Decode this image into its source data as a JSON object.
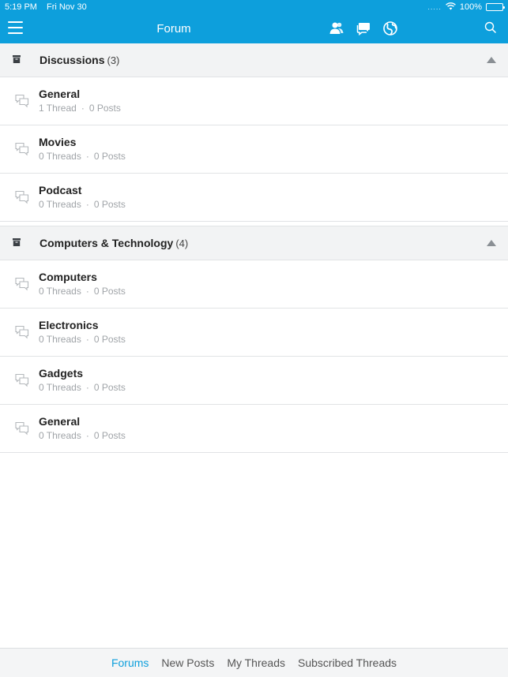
{
  "status_bar": {
    "time": "5:19 PM",
    "date": "Fri Nov 30",
    "battery": "100%",
    "signal_dots": "....."
  },
  "navbar": {
    "title": "Forum",
    "icons": [
      "members-icon",
      "conversations-icon",
      "globe-icon",
      "search-icon"
    ]
  },
  "categories": [
    {
      "title": "Discussions",
      "count": "(3)",
      "forums": [
        {
          "name": "General",
          "threads": "1 Thread",
          "posts": "0 Posts"
        },
        {
          "name": "Movies",
          "threads": "0 Threads",
          "posts": "0 Posts"
        },
        {
          "name": "Podcast",
          "threads": "0 Threads",
          "posts": "0 Posts"
        }
      ]
    },
    {
      "title": "Computers & Technology",
      "count": "(4)",
      "forums": [
        {
          "name": "Computers",
          "threads": "0 Threads",
          "posts": "0 Posts"
        },
        {
          "name": "Electronics",
          "threads": "0 Threads",
          "posts": "0 Posts"
        },
        {
          "name": "Gadgets",
          "threads": "0 Threads",
          "posts": "0 Posts"
        },
        {
          "name": "General",
          "threads": "0 Threads",
          "posts": "0 Posts"
        }
      ]
    }
  ],
  "tabs": [
    {
      "label": "Forums",
      "active": true
    },
    {
      "label": "New Posts",
      "active": false
    },
    {
      "label": "My Threads",
      "active": false
    },
    {
      "label": "Subscribed Threads",
      "active": false
    }
  ],
  "colors": {
    "accent": "#0d9fdc",
    "header_bg": "#f2f3f4",
    "meta_text": "#a0a4a8"
  }
}
